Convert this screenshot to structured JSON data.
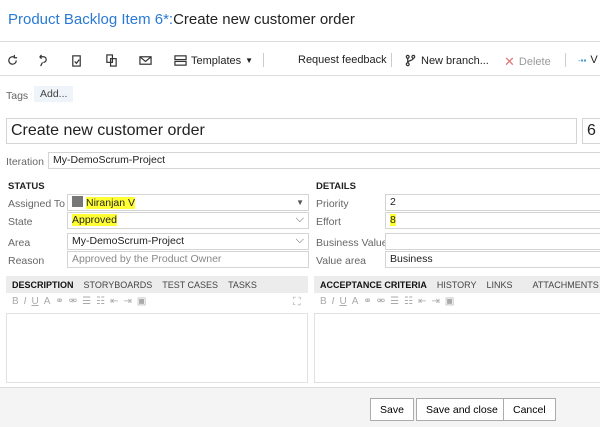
{
  "header": {
    "prefix": "Product Backlog Item 6*:",
    "title": "Create new customer order"
  },
  "toolbar": {
    "templates": "Templates",
    "request_feedback": "Request feedback",
    "new_branch": "New branch...",
    "delete": "Delete",
    "more": "V"
  },
  "tags": {
    "label": "Tags",
    "add": "Add..."
  },
  "work_item": {
    "title": "Create new customer order",
    "id": "6"
  },
  "iteration": {
    "label": "Iteration",
    "value": "My-DemoScrum-Project"
  },
  "status": {
    "heading": "STATUS",
    "assigned_to": {
      "label": "Assigned To",
      "value": "Niranjan V"
    },
    "state": {
      "label": "State",
      "value": "Approved"
    },
    "area": {
      "label": "Area",
      "value": "My-DemoScrum-Project"
    },
    "reason": {
      "label": "Reason",
      "value": "Approved by the Product Owner"
    }
  },
  "details": {
    "heading": "DETAILS",
    "priority": {
      "label": "Priority",
      "value": "2"
    },
    "effort": {
      "label": "Effort",
      "value": "8"
    },
    "business_value": {
      "label": "Business Value",
      "value": ""
    },
    "value_area": {
      "label": "Value area",
      "value": "Business"
    }
  },
  "left_tabs": [
    "DESCRIPTION",
    "STORYBOARDS",
    "TEST CASES",
    "TASKS"
  ],
  "right_tabs": [
    "ACCEPTANCE CRITERIA",
    "HISTORY",
    "LINKS",
    "ATTACHMENTS"
  ],
  "rte_buttons": [
    "B",
    "I",
    "U",
    "A",
    "⚭",
    "⚮",
    "☰",
    "☷",
    "⇤",
    "⇥",
    "▣"
  ],
  "footer": {
    "save": "Save",
    "save_close": "Save and close",
    "cancel": "Cancel"
  }
}
